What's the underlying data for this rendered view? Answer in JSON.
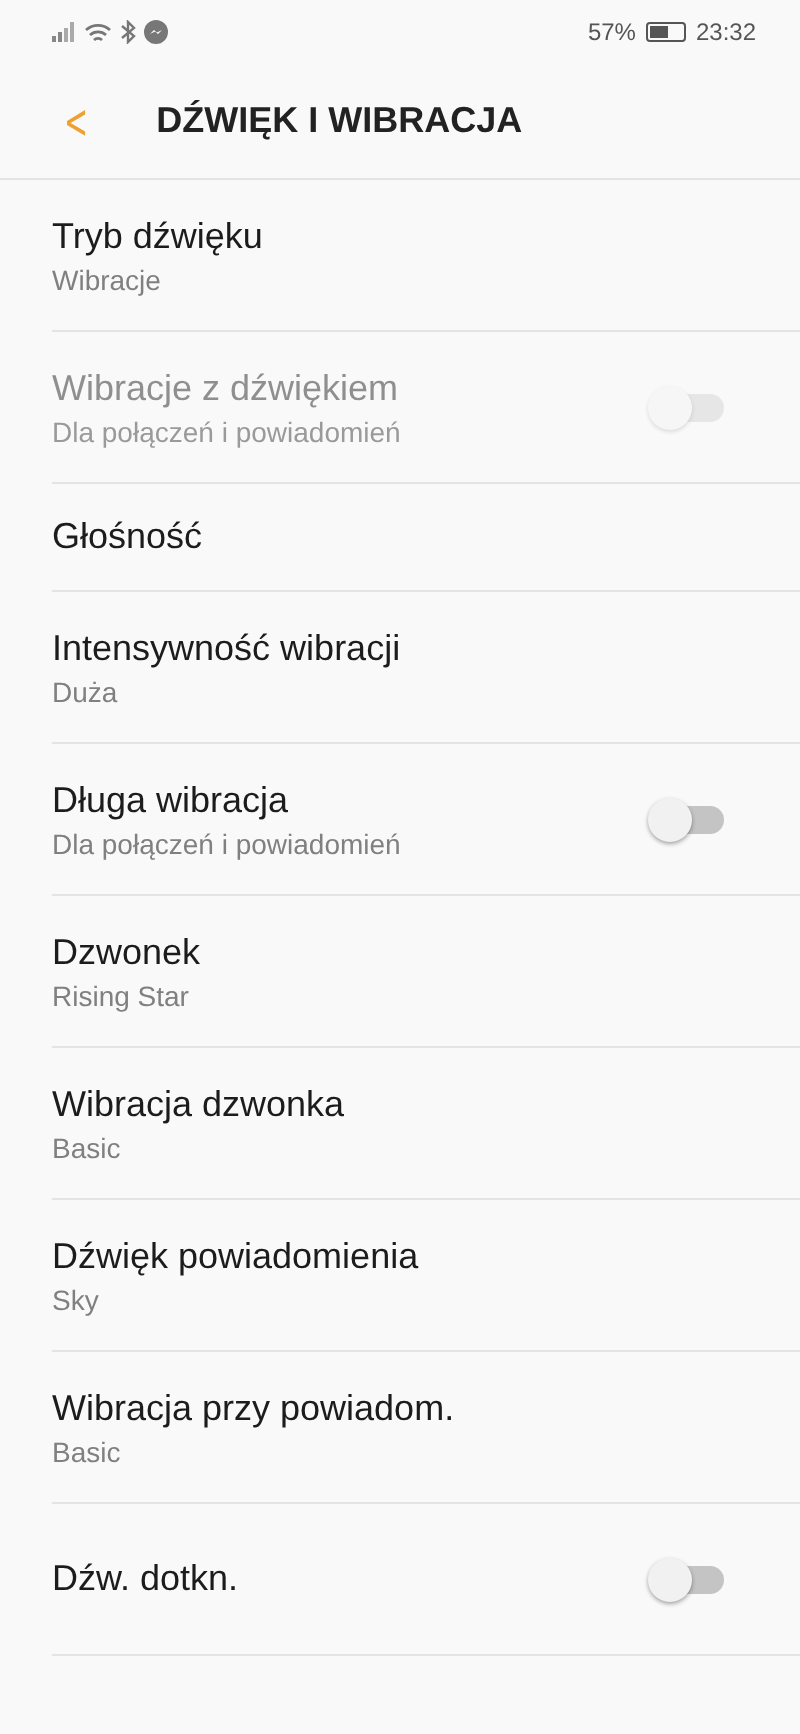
{
  "status_bar": {
    "battery_text": "57%",
    "time": "23:32"
  },
  "header": {
    "back": "<",
    "title": "DŹWIĘK I WIBRACJA"
  },
  "items": [
    {
      "kind": "nav",
      "title": "Tryb dźwięku",
      "subtitle": "Wibracje",
      "disabled": false
    },
    {
      "kind": "toggle",
      "title": "Wibracje z dźwiękiem",
      "subtitle": "Dla połączeń i powiadomień",
      "disabled": true,
      "on": false
    },
    {
      "kind": "nav",
      "title": "Głośność",
      "disabled": false
    },
    {
      "kind": "nav",
      "title": "Intensywność wibracji",
      "subtitle": "Duża",
      "disabled": false
    },
    {
      "kind": "toggle",
      "title": "Długa wibracja",
      "subtitle": "Dla połączeń i powiadomień",
      "disabled": false,
      "on": false
    },
    {
      "kind": "nav",
      "title": "Dzwonek",
      "subtitle": "Rising Star",
      "disabled": false
    },
    {
      "kind": "nav",
      "title": "Wibracja dzwonka",
      "subtitle": "Basic",
      "disabled": false
    },
    {
      "kind": "nav",
      "title": "Dźwięk powiadomienia",
      "subtitle": "Sky",
      "disabled": false
    },
    {
      "kind": "nav",
      "title": "Wibracja przy powiadom.",
      "subtitle": "Basic",
      "disabled": false
    },
    {
      "kind": "toggle",
      "title": "Dźw. dotkn.",
      "disabled": false,
      "on": false
    }
  ]
}
